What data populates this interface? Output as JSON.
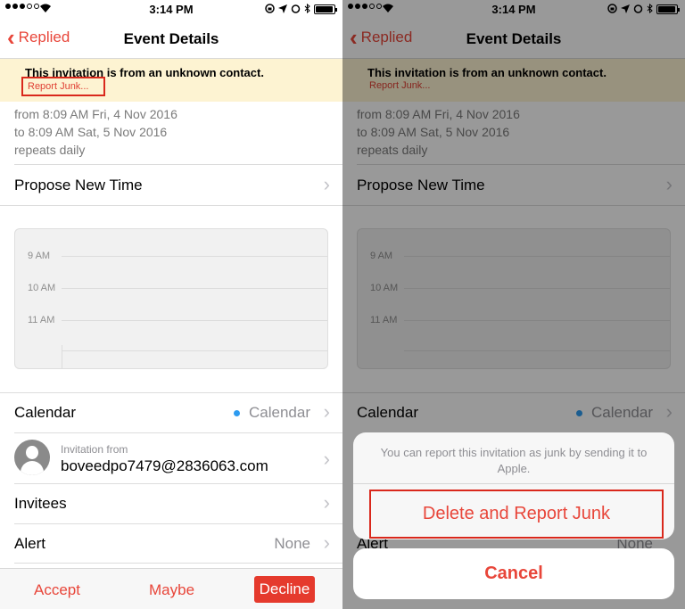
{
  "status": {
    "time": "3:14 PM",
    "left_icons": [
      "signal-dots",
      "wifi"
    ],
    "right_icons": [
      "lock-rotation",
      "location-arrow",
      "alarm",
      "bluetooth",
      "battery"
    ],
    "battery_level": 0.85
  },
  "nav": {
    "back_label": "Replied",
    "title": "Event Details"
  },
  "banner": {
    "text": "This invitation is from an unknown contact.",
    "link": "Report Junk..."
  },
  "event": {
    "from": "from 8:09 AM Fri, 4 Nov 2016",
    "to": "to 8:09 AM Sat, 5 Nov 2016",
    "repeat": "repeats daily"
  },
  "propose_label": "Propose New Time",
  "timeline": {
    "hours": [
      "9 AM",
      "10 AM",
      "11 AM"
    ]
  },
  "calendar": {
    "label": "Calendar",
    "value": "Calendar",
    "dot_color": "#2d9bf0"
  },
  "invitation": {
    "label": "Invitation from",
    "email": "boveedpo7479@2836063.com"
  },
  "invitees_label": "Invitees",
  "alert": {
    "label": "Alert",
    "value": "None"
  },
  "toolbar": {
    "accept": "Accept",
    "maybe": "Maybe",
    "decline": "Decline"
  },
  "action_sheet": {
    "message": "You can report this invitation as junk by sending it to Apple.",
    "action": "Delete and Report Junk",
    "cancel": "Cancel"
  },
  "colors": {
    "accent": "#e8463a",
    "highlight_box": "#d9281c",
    "banner_bg": "#fdf3d2"
  }
}
